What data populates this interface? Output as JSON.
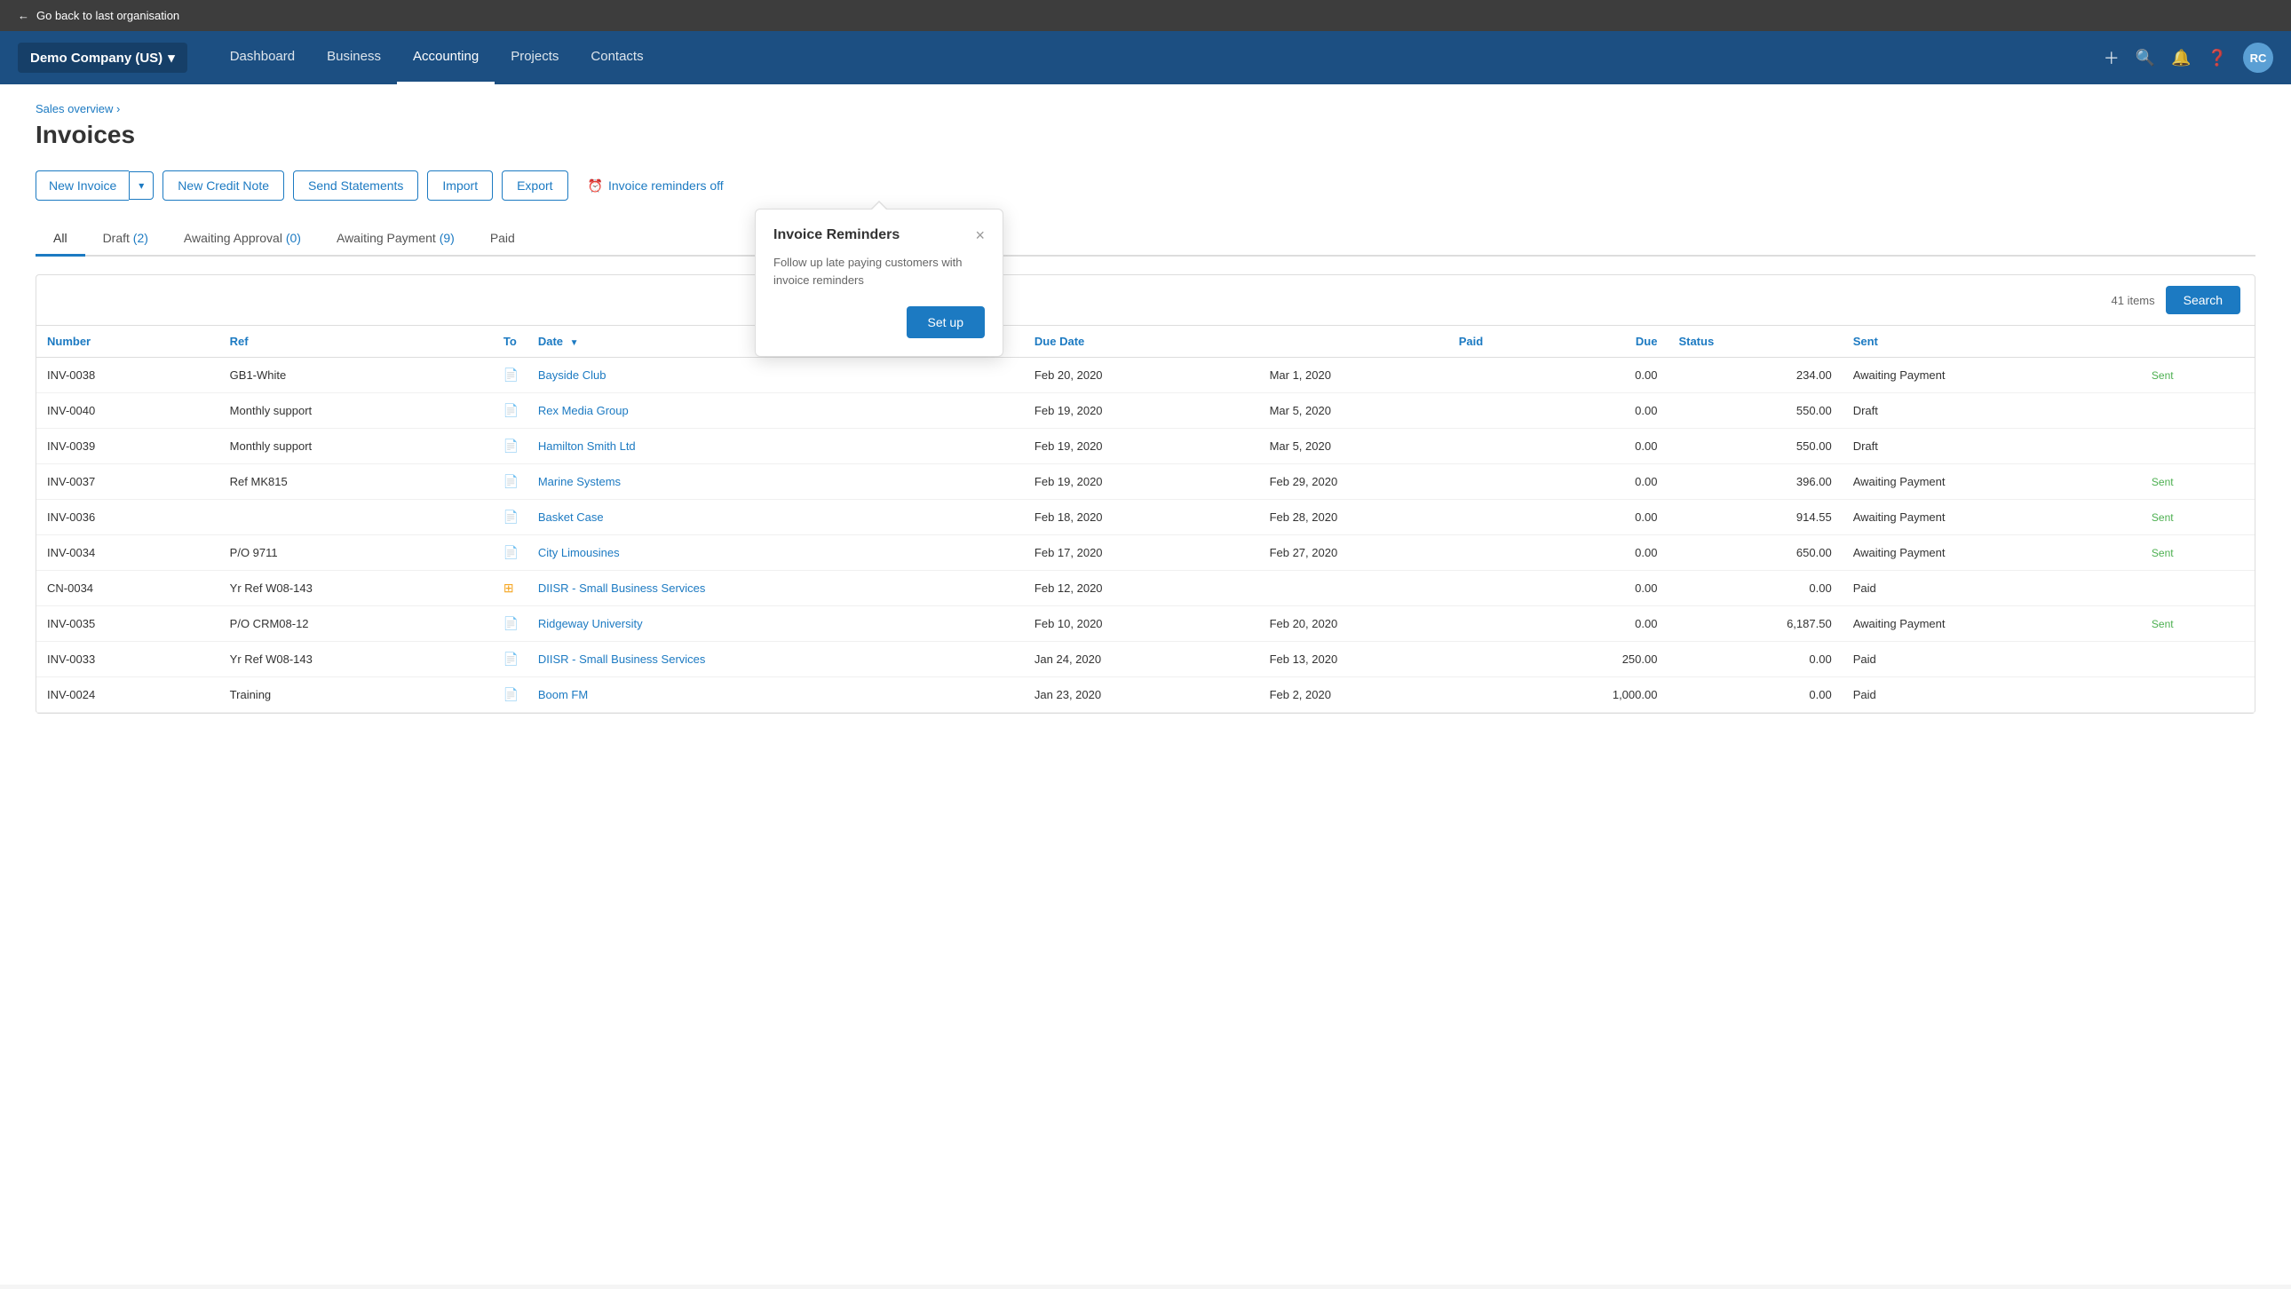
{
  "topbar": {
    "back_label": "Go back to last organisation"
  },
  "nav": {
    "brand_label": "Demo Company (US)",
    "brand_chevron": "▾",
    "links": [
      {
        "id": "dashboard",
        "label": "Dashboard",
        "active": false
      },
      {
        "id": "business",
        "label": "Business",
        "active": false
      },
      {
        "id": "accounting",
        "label": "Accounting",
        "active": true
      },
      {
        "id": "projects",
        "label": "Projects",
        "active": false
      },
      {
        "id": "contacts",
        "label": "Contacts",
        "active": false
      }
    ],
    "avatar_label": "RC"
  },
  "breadcrumb": "Sales overview ›",
  "page_title": "Invoices",
  "toolbar": {
    "new_invoice_label": "New Invoice",
    "new_credit_note_label": "New Credit Note",
    "send_statements_label": "Send Statements",
    "import_label": "Import",
    "export_label": "Export",
    "reminders_label": "Invoice reminders off"
  },
  "tabs": [
    {
      "id": "all",
      "label": "All",
      "count": null,
      "active": true
    },
    {
      "id": "draft",
      "label": "Draft",
      "count": 2,
      "active": false
    },
    {
      "id": "awaiting_approval",
      "label": "Awaiting Approval",
      "count": 0,
      "active": false
    },
    {
      "id": "awaiting_payment",
      "label": "Awaiting Payment",
      "count": 9,
      "active": false
    },
    {
      "id": "paid",
      "label": "Paid",
      "count": null,
      "active": false
    }
  ],
  "table": {
    "items_count": "41 items",
    "search_label": "Search",
    "columns": [
      {
        "id": "number",
        "label": "Number"
      },
      {
        "id": "ref",
        "label": "Ref"
      },
      {
        "id": "to",
        "label": "To"
      },
      {
        "id": "date",
        "label": "Date",
        "sort": "▼"
      },
      {
        "id": "due_date",
        "label": "Due Date"
      },
      {
        "id": "paid",
        "label": "Paid"
      },
      {
        "id": "due",
        "label": "Due"
      },
      {
        "id": "status",
        "label": "Status"
      },
      {
        "id": "sent",
        "label": "Sent"
      }
    ],
    "rows": [
      {
        "number": "INV-0038",
        "ref": "GB1-White",
        "doc_icon": "doc",
        "to": "Bayside Club",
        "date": "Feb 20, 2020",
        "due_date": "Mar 1, 2020",
        "paid": "0.00",
        "due": "234.00",
        "status": "Awaiting Payment",
        "sent": "Sent"
      },
      {
        "number": "INV-0040",
        "ref": "Monthly support",
        "doc_icon": "doc",
        "to": "Rex Media Group",
        "date": "Feb 19, 2020",
        "due_date": "Mar 5, 2020",
        "paid": "0.00",
        "due": "550.00",
        "status": "Draft",
        "sent": ""
      },
      {
        "number": "INV-0039",
        "ref": "Monthly support",
        "doc_icon": "doc",
        "to": "Hamilton Smith Ltd",
        "date": "Feb 19, 2020",
        "due_date": "Mar 5, 2020",
        "paid": "0.00",
        "due": "550.00",
        "status": "Draft",
        "sent": ""
      },
      {
        "number": "INV-0037",
        "ref": "Ref MK815",
        "doc_icon": "doc",
        "to": "Marine Systems",
        "date": "Feb 19, 2020",
        "due_date": "Feb 29, 2020",
        "paid": "0.00",
        "due": "396.00",
        "status": "Awaiting Payment",
        "sent": "Sent"
      },
      {
        "number": "INV-0036",
        "ref": "",
        "doc_icon": "doc",
        "to": "Basket Case",
        "date": "Feb 18, 2020",
        "due_date": "Feb 28, 2020",
        "paid": "0.00",
        "due": "914.55",
        "status": "Awaiting Payment",
        "sent": "Sent"
      },
      {
        "number": "INV-0034",
        "ref": "P/O 9711",
        "doc_icon": "doc",
        "to": "City Limousines",
        "date": "Feb 17, 2020",
        "due_date": "Feb 27, 2020",
        "paid": "0.00",
        "due": "650.00",
        "status": "Awaiting Payment",
        "sent": "Sent"
      },
      {
        "number": "CN-0034",
        "ref": "Yr Ref W08-143",
        "doc_icon": "cn",
        "to": "DIISR - Small Business Services",
        "date": "Feb 12, 2020",
        "due_date": "",
        "paid": "0.00",
        "due": "0.00",
        "status": "Paid",
        "sent": ""
      },
      {
        "number": "INV-0035",
        "ref": "P/O CRM08-12",
        "doc_icon": "doc",
        "to": "Ridgeway University",
        "date": "Feb 10, 2020",
        "due_date": "Feb 20, 2020",
        "paid": "0.00",
        "due": "6,187.50",
        "status": "Awaiting Payment",
        "sent": "Sent"
      },
      {
        "number": "INV-0033",
        "ref": "Yr Ref W08-143",
        "doc_icon": "doc2",
        "to": "DIISR - Small Business Services",
        "date": "Jan 24, 2020",
        "due_date": "Feb 13, 2020",
        "paid": "250.00",
        "due": "0.00",
        "status": "Paid",
        "sent": ""
      },
      {
        "number": "INV-0024",
        "ref": "Training",
        "doc_icon": "doc",
        "to": "Boom FM",
        "date": "Jan 23, 2020",
        "due_date": "Feb 2, 2020",
        "paid": "1,000.00",
        "due": "0.00",
        "status": "Paid",
        "sent": ""
      }
    ]
  },
  "popover": {
    "title": "Invoice Reminders",
    "body": "Follow up late paying customers with invoice reminders",
    "setup_label": "Set up"
  }
}
